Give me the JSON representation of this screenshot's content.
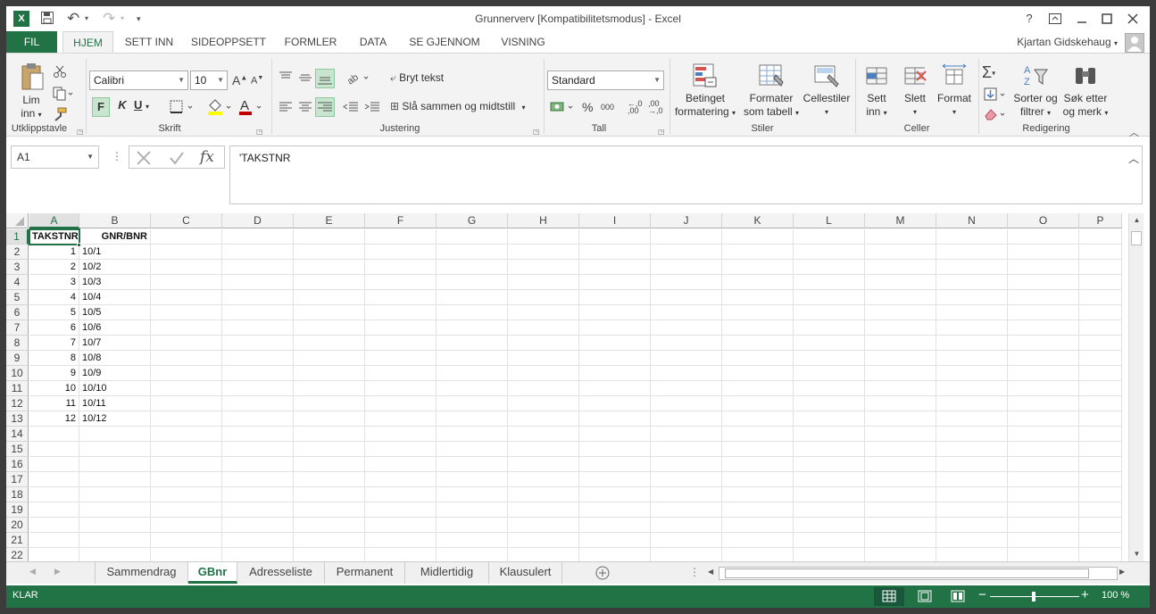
{
  "window": {
    "title": "Grunnerverv  [Kompatibilitetsmodus] - Excel",
    "help": "?",
    "controls": [
      "restore-ribbon",
      "minimize",
      "maximize",
      "close"
    ]
  },
  "qat": {
    "undo": "↶",
    "redo": "↷"
  },
  "tabs": [
    {
      "label": "FIL"
    },
    {
      "label": "HJEM"
    },
    {
      "label": "SETT INN"
    },
    {
      "label": "SIDEOPPSETT"
    },
    {
      "label": "FORMLER"
    },
    {
      "label": "DATA"
    },
    {
      "label": "SE GJENNOM"
    },
    {
      "label": "VISNING"
    }
  ],
  "user": {
    "name": "Kjartan Gidskehaug"
  },
  "ribbon": {
    "clipboard": {
      "paste_line1": "Lim",
      "paste_line2": "inn",
      "group": "Utklippstavle"
    },
    "font": {
      "name": "Calibri",
      "size": "10",
      "bold": "F",
      "italic": "K",
      "underline": "U",
      "group": "Skrift"
    },
    "alignment": {
      "wrap": "Bryt tekst",
      "merge": "Slå sammen og midtstill",
      "group": "Justering"
    },
    "number": {
      "format": "Standard",
      "percent": "%",
      "thousands": "000",
      "dec_inc": ",0 ,00",
      "dec_dec": ",00 ,0",
      "group": "Tall"
    },
    "styles": {
      "conditional_1": "Betinget",
      "conditional_2": "formatering",
      "table_1": "Formater",
      "table_2": "som tabell",
      "cellstyles": "Cellestiler",
      "group": "Stiler"
    },
    "cells": {
      "insert_1": "Sett",
      "insert_2": "inn",
      "delete": "Slett",
      "format": "Format",
      "group": "Celler"
    },
    "editing": {
      "sort_1": "Sorter og",
      "sort_2": "filtrer",
      "find_1": "Søk etter",
      "find_2": "og merk",
      "group": "Redigering"
    }
  },
  "formula_bar": {
    "namebox": "A1",
    "content": "'TAKSTNR"
  },
  "grid": {
    "columns": [
      "A",
      "B",
      "C",
      "D",
      "E",
      "F",
      "G",
      "H",
      "I",
      "J",
      "K",
      "L",
      "M",
      "N",
      "O",
      "P"
    ],
    "rows": [
      "1",
      "2",
      "3",
      "4",
      "5",
      "6",
      "7",
      "8",
      "9",
      "10",
      "11",
      "12",
      "13",
      "14",
      "15",
      "16",
      "17",
      "18",
      "19",
      "20",
      "21",
      "22"
    ],
    "header": {
      "a": "TAKSTNR",
      "b": "GNR/BNR"
    },
    "data": [
      {
        "a": "1",
        "b": "10/1"
      },
      {
        "a": "2",
        "b": "10/2"
      },
      {
        "a": "3",
        "b": "10/3"
      },
      {
        "a": "4",
        "b": "10/4"
      },
      {
        "a": "5",
        "b": "10/5"
      },
      {
        "a": "6",
        "b": "10/6"
      },
      {
        "a": "7",
        "b": "10/7"
      },
      {
        "a": "8",
        "b": "10/8"
      },
      {
        "a": "9",
        "b": "10/9"
      },
      {
        "a": "10",
        "b": "10/10"
      },
      {
        "a": "11",
        "b": "10/11"
      },
      {
        "a": "12",
        "b": "10/12"
      }
    ]
  },
  "sheets": [
    "Sammendrag",
    "GBnr",
    "Adresseliste",
    "Permanent",
    "Midlertidig",
    "Klausulert"
  ],
  "active_sheet": "GBnr",
  "status": {
    "mode": "KLAR",
    "zoom": "100 %"
  },
  "colors": {
    "accent": "#217346",
    "ribbon_bg": "#f3f3f3"
  }
}
